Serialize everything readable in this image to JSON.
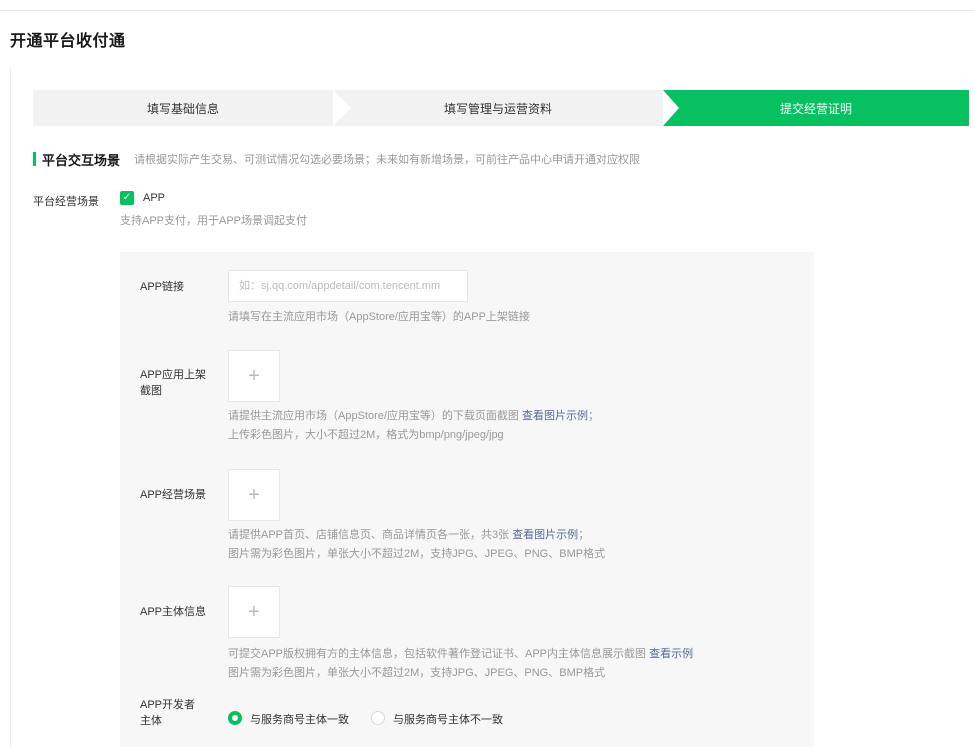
{
  "page": {
    "title": "开通平台收付通"
  },
  "steps": [
    {
      "label": "填写基础信息",
      "state": "done"
    },
    {
      "label": "填写管理与运营资料",
      "state": "done"
    },
    {
      "label": "提交经营证明",
      "state": "active"
    }
  ],
  "section": {
    "title": "平台交互场景",
    "desc": "请根据实际产生交易、可测试情况勾选必要场景；未来如有新增场景，可前往产品中心申请开通对应权限"
  },
  "scene": {
    "label": "平台经营场景",
    "option": "APP",
    "checked": true,
    "hint": "支持APP支付，用于APP场景调起支付"
  },
  "app_link": {
    "label": "APP链接",
    "placeholder": "如：sj.qq.com/appdetail/com.tencent.mm",
    "hint": "请填写在主流应用市场（AppStore/应用宝等）的APP上架链接"
  },
  "app_screenshot": {
    "label_line1": "APP应用上架",
    "label_line2": "截图",
    "hint_line1": "请提供主流应用市场（AppStore/应用宝等）的下载页面截图 ",
    "hint_link": "查看图片示例",
    "hint_tail": "；",
    "hint_line2": "上传彩色图片，大小不超过2M，格式为bmp/png/jpeg/jpg"
  },
  "app_scene": {
    "label": "APP经营场景",
    "hint_line1": "请提供APP首页、店铺信息页、商品详情页各一张，共3张 ",
    "hint_link": "查看图片示例",
    "hint_tail": "；",
    "hint_line2": "图片需为彩色图片，单张大小不超过2M，支持JPG、JPEG、PNG、BMP格式"
  },
  "app_entity": {
    "label": "APP主体信息",
    "hint_line1": "可提交APP版权拥有方的主体信息，包括软件著作登记证书、APP内主体信息展示截图 ",
    "hint_link": "查看示例",
    "hint_line2": "图片需为彩色图片，单张大小不超过2M，支持JPG、JPEG、PNG、BMP格式"
  },
  "app_developer": {
    "label_line1": "APP开发者",
    "label_line2": "主体",
    "options": [
      {
        "label": "与服务商号主体一致",
        "selected": true
      },
      {
        "label": "与服务商号主体不一致",
        "selected": false
      }
    ]
  },
  "upload_symbol": "+",
  "colors": {
    "accent": "#07c160",
    "link": "#576b95",
    "hint": "#999999"
  }
}
